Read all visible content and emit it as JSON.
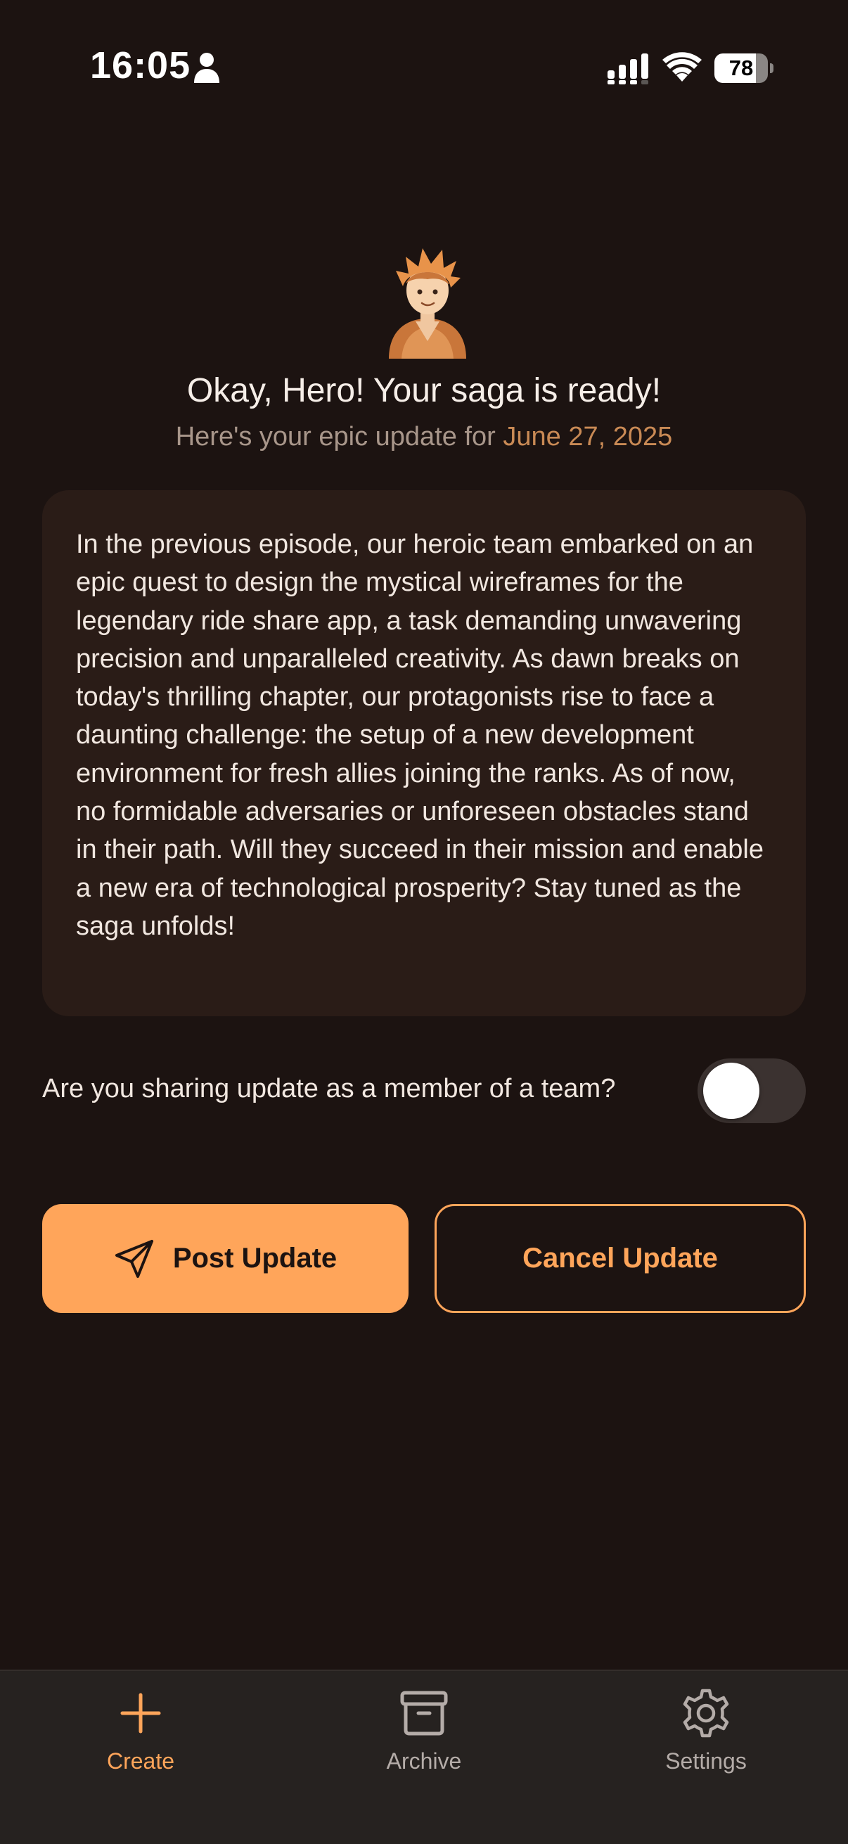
{
  "status_bar": {
    "time": "16:05",
    "battery_level": "78",
    "battery_fraction": 0.78
  },
  "hero": {
    "title": "Okay, Hero! Your saga is ready!",
    "subtitle_prefix": "Here's your epic update for ",
    "date": "June 27, 2025"
  },
  "story": {
    "text": "In the previous episode, our heroic team embarked on an epic quest to design the mystical wireframes for the legendary ride share app, a task demanding unwavering precision and unparalleled creativity. As dawn breaks on today's thrilling chapter, our protagonists rise to face a daunting challenge: the setup of a new development environment for fresh allies joining the ranks. As of now, no formidable adversaries or unforeseen obstacles stand in their path. Will they succeed in their mission and enable a new era of technological prosperity? Stay tuned as the saga unfolds!"
  },
  "team": {
    "question": "Are you sharing update as a member of a team?",
    "toggle_on": false
  },
  "actions": {
    "post_label": "Post Update",
    "cancel_label": "Cancel Update"
  },
  "nav": {
    "items": [
      {
        "label": "Create",
        "icon": "plus-icon",
        "active": true
      },
      {
        "label": "Archive",
        "icon": "archive-box-icon",
        "active": false
      },
      {
        "label": "Settings",
        "icon": "gear-icon",
        "active": false
      }
    ]
  },
  "colors": {
    "background": "#1c1311",
    "card": "#2a1c17",
    "accent": "#ffa55a",
    "date_accent": "#c98a55",
    "nav_background": "#262220",
    "muted_text": "#a8968a"
  }
}
